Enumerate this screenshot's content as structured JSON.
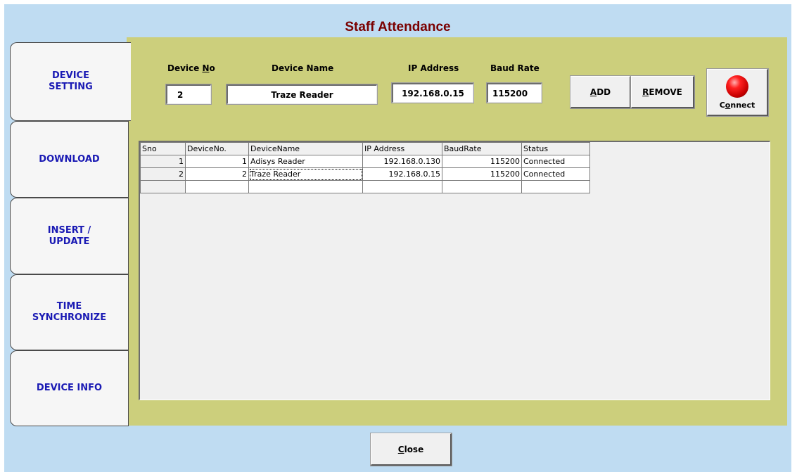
{
  "window": {
    "title": "Staff Attendance"
  },
  "tabs": [
    {
      "label": "DEVICE\nSETTING"
    },
    {
      "label": "DOWNLOAD"
    },
    {
      "label": "INSERT /\nUPDATE"
    },
    {
      "label": "TIME\nSYNCHRONIZE"
    },
    {
      "label": "DEVICE INFO"
    }
  ],
  "form": {
    "device_no_label_pre": "Device ",
    "device_no_label_ul": "N",
    "device_no_label_post": "o",
    "device_name_label": "Device Name",
    "ip_label": "IP Address",
    "baud_label": "Baud Rate",
    "device_no_value": "2",
    "device_name_value": "Traze Reader",
    "ip_value": "192.168.0.15",
    "baud_value": "115200"
  },
  "buttons": {
    "add_ul": "A",
    "add_rest": "DD",
    "remove_ul": "R",
    "remove_rest": "EMOVE",
    "connect_pre": "C",
    "connect_ul": "o",
    "connect_rest": "nnect",
    "close_ul": "C",
    "close_rest": "lose"
  },
  "grid": {
    "columns": [
      "Sno",
      "DeviceNo.",
      "DeviceName",
      "IP Address",
      "BaudRate",
      "Status"
    ],
    "rows": [
      [
        "1",
        "1",
        "Adisys Reader",
        "192.168.0.130",
        "115200",
        "Connected"
      ],
      [
        "2",
        "2",
        "Traze Reader",
        "192.168.0.15",
        "115200",
        "Connected"
      ]
    ]
  },
  "colors": {
    "title": "#7a0000",
    "tab_text": "#1a1ab4",
    "panel": "#cccf7c",
    "frame": "#bfdcf2"
  },
  "icons": {
    "connect": "red-status-orb-icon"
  }
}
